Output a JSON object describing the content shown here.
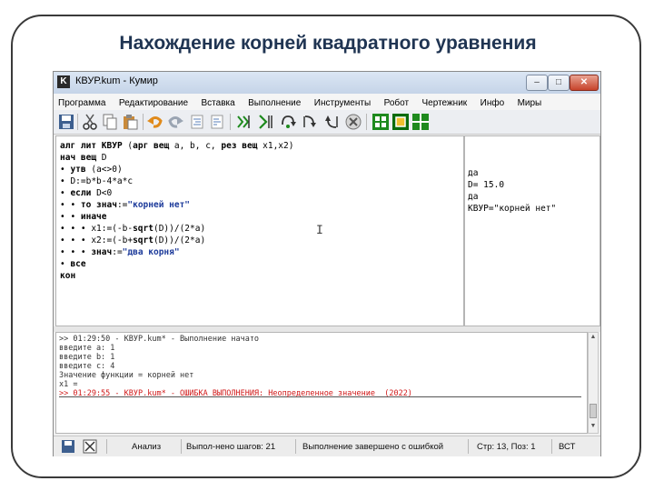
{
  "slide": {
    "title": "Нахождение корней квадратного уравнения"
  },
  "window": {
    "app_icon_letter": "K",
    "title": "КВУР.kum - Кумир",
    "buttons": {
      "minimize": "–",
      "maximize": "□",
      "close": "✕"
    }
  },
  "menu": [
    "Программа",
    "Редактирование",
    "Вставка",
    "Выполнение",
    "Инструменты",
    "Робот",
    "Чертежник",
    "Инфо",
    "Миры"
  ],
  "toolbar": {
    "icons": [
      "save-icon",
      "cut-icon",
      "copy-icon",
      "paste-icon",
      "undo-icon",
      "redo-icon",
      "indent-icon",
      "unindent-icon",
      "run-icon",
      "step-icon",
      "step-over-icon",
      "step-into-icon",
      "step-out-icon",
      "stop-icon",
      "robot-window-icon",
      "robot-field-icon",
      "draftsman-window-icon"
    ],
    "colors": {
      "green": "#1e8a1e",
      "dark_green": "#0c6b0c",
      "orange": "#e08a1a",
      "red": "#c0392b"
    }
  },
  "code": [
    [
      {
        "t": "алг ",
        "k": 1
      },
      {
        "t": "лит ",
        "k": 1
      },
      {
        "t": "КВУР",
        "k": 1
      },
      {
        "t": " (",
        "k": 0
      },
      {
        "t": "арг вещ",
        "k": 1
      },
      {
        "t": " a, b, c, ",
        "k": 0
      },
      {
        "t": "рез вещ",
        "k": 1
      },
      {
        "t": " x1,x2)",
        "k": 0
      }
    ],
    [
      {
        "t": "нач ",
        "k": 1
      },
      {
        "t": "вещ",
        "k": 1
      },
      {
        "t": " D",
        "k": 0
      }
    ],
    [
      {
        "t": "• ",
        "k": 0
      },
      {
        "t": "утв",
        "k": 1
      },
      {
        "t": " (a<>0)",
        "k": 0
      }
    ],
    [
      {
        "t": "• D:=b*b-4*a*c",
        "k": 0
      }
    ],
    [
      {
        "t": "• ",
        "k": 0
      },
      {
        "t": "если",
        "k": 1
      },
      {
        "t": " D<0",
        "k": 0
      }
    ],
    [
      {
        "t": "• • ",
        "k": 0
      },
      {
        "t": "то знач",
        "k": 1
      },
      {
        "t": ":=",
        "k": 0
      },
      {
        "t": "\"корней нет\"",
        "k": 2
      }
    ],
    [
      {
        "t": "• • ",
        "k": 0
      },
      {
        "t": "иначе",
        "k": 1
      }
    ],
    [
      {
        "t": "• • • x1:=(-b-",
        "k": 0
      },
      {
        "t": "sqrt",
        "k": 1
      },
      {
        "t": "(D))/(2*a)",
        "k": 0
      }
    ],
    [
      {
        "t": "• • • x2:=(-b+",
        "k": 0
      },
      {
        "t": "sqrt",
        "k": 1
      },
      {
        "t": "(D))/(2*a)",
        "k": 0
      }
    ],
    [
      {
        "t": "• • • ",
        "k": 0
      },
      {
        "t": "знач",
        "k": 1
      },
      {
        "t": ":=",
        "k": 0
      },
      {
        "t": "\"два корня\"",
        "k": 2
      }
    ],
    [
      {
        "t": "• ",
        "k": 0
      },
      {
        "t": "все",
        "k": 1
      }
    ],
    [
      {
        "t": "кон",
        "k": 1
      }
    ]
  ],
  "margin_lines": [
    {
      "row": 2,
      "text": "да"
    },
    {
      "row": 3,
      "text": "D= 15.0"
    },
    {
      "row": 4,
      "text": "да"
    },
    {
      "row": 5,
      "text": "КВУР=\"корней нет\""
    }
  ],
  "console": [
    {
      "text": ">> 01:29:50 - КВУР.kum* - Выполнение начато",
      "error": false
    },
    {
      "text": "введите a: 1",
      "error": false
    },
    {
      "text": "введите b: 1",
      "error": false
    },
    {
      "text": "введите c: 4",
      "error": false
    },
    {
      "text": "Значение функции = корней нет",
      "error": false
    },
    {
      "text": "x1 =",
      "error": false
    },
    {
      "text": ">> 01:29:55 - КВУР.kum* - ОШИБКА ВЫПОЛНЕНИЯ: Неопределенное значение  (2022)",
      "error": true
    }
  ],
  "status": {
    "mode": "Анализ",
    "steps": "Выпол-нено шагов: 21",
    "result": "Выполнение завершено с ошибкой",
    "position": "Стр: 13, Поз: 1",
    "insert": "ВСТ"
  }
}
